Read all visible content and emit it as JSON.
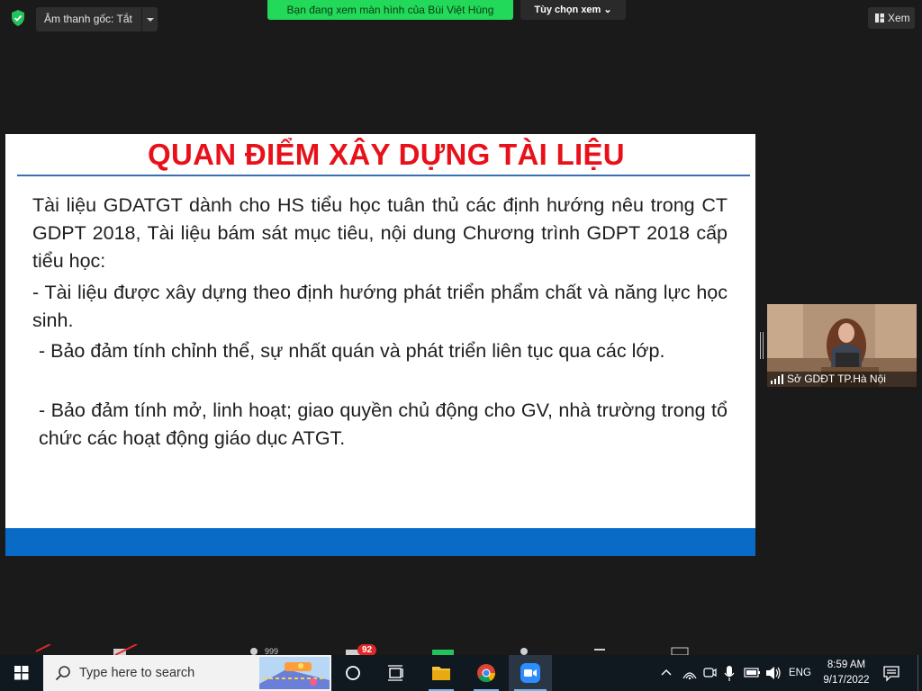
{
  "topbar": {
    "audio_label": "Âm thanh gốc: Tắt",
    "sharing_text": "Bạn đang xem màn hình của Bùi Việt Hùng",
    "view_options": "Tùy chọn xem ⌄",
    "view_right": "Xem"
  },
  "slide": {
    "title": "QUAN ĐIỂM XÂY DỰNG TÀI LIỆU",
    "p1": "Tài liệu GDATGT dành cho HS tiểu học tuân thủ các định hướng nêu trong CT GDPT 2018, Tài liệu bám sát mục tiêu, nội dung Chương trình GDPT 2018 cấp tiểu học:",
    "p2": "- Tài liệu được xây dựng theo định hướng phát triển phẩm chất và năng lực học sinh.",
    "p3": "- Bảo đảm tính chỉnh thể, sự nhất quán và phát triển liên tục qua các lớp.",
    "p4": "- Bảo đảm tính mở, linh hoạt; giao quyền chủ động cho GV, nhà trường trong tổ chức các hoạt động giáo dục ATGT.",
    "footer_color": "#0a6bc7",
    "title_color": "#e8111a"
  },
  "video": {
    "participant_name": "Sở GDĐT TP.Hà Nội"
  },
  "toolbar": {
    "chat_badge": "92"
  },
  "taskbar": {
    "search_placeholder": "Type here to search",
    "language": "ENG",
    "time": "8:59 AM",
    "date": "9/17/2022"
  },
  "icons": [
    "shield-icon",
    "chevron-down-icon",
    "view-grid-icon",
    "windows-logo-icon",
    "search-icon",
    "cortana-icon",
    "task-view-icon",
    "file-explorer-icon",
    "chrome-icon",
    "zoom-icon",
    "chevron-up-icon",
    "network-icon",
    "meet-now-icon",
    "microphone-icon",
    "battery-icon",
    "volume-icon",
    "notification-icon"
  ]
}
